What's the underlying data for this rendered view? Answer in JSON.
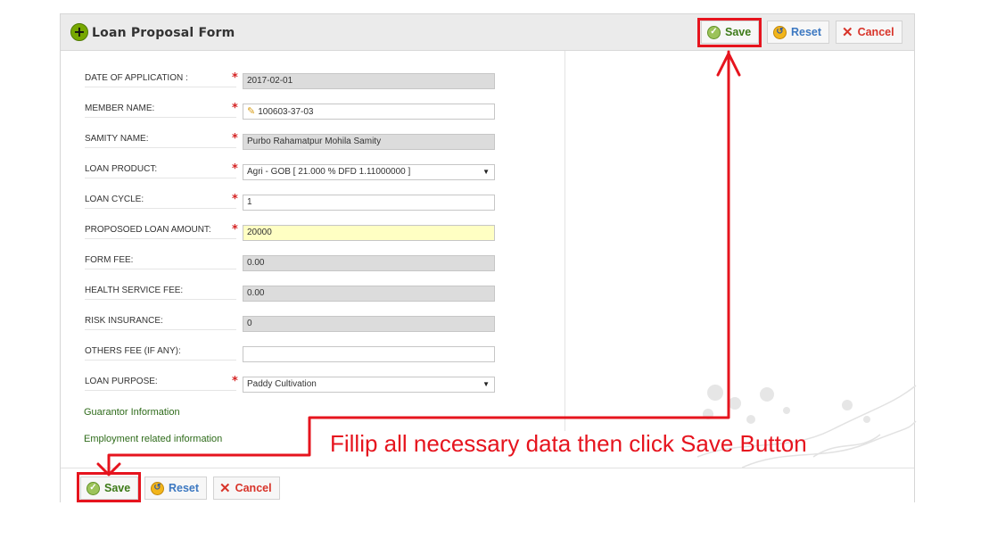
{
  "form": {
    "title": "Loan Proposal Form"
  },
  "toolbar": {
    "save_label": "Save",
    "reset_label": "Reset",
    "cancel_label": "Cancel"
  },
  "fields": {
    "date_of_application": {
      "label": "DATE OF APPLICATION :",
      "value": "2017-02-01",
      "required": true
    },
    "member_name": {
      "label": "MEMBER NAME:",
      "value": "100603-37-03",
      "required": true
    },
    "samity_name": {
      "label": "SAMITY NAME:",
      "value": "Purbo Rahamatpur Mohila Samity",
      "required": true
    },
    "loan_product": {
      "label": "LOAN PRODUCT:",
      "value": "Agri - GOB [ 21.000 % DFD 1.11000000 ]",
      "required": true
    },
    "loan_cycle": {
      "label": "LOAN CYCLE:",
      "value": "1",
      "required": true
    },
    "proposed_loan_amount": {
      "label": "PROPOSOED LOAN AMOUNT:",
      "value": "20000",
      "required": true
    },
    "form_fee": {
      "label": "FORM FEE:",
      "value": "0.00",
      "required": false
    },
    "health_service_fee": {
      "label": "HEALTH SERVICE FEE:",
      "value": "0.00",
      "required": false
    },
    "risk_insurance": {
      "label": "RISK INSURANCE:",
      "value": "0",
      "required": false
    },
    "others_fee": {
      "label": "OTHERS FEE (IF ANY):",
      "value": "",
      "required": false
    },
    "loan_purpose": {
      "label": "LOAN PURPOSE:",
      "value": "Paddy Cultivation",
      "required": true
    }
  },
  "links": {
    "guarantor": "Guarantor Information",
    "employment": "Employment related information"
  },
  "annotation": {
    "text": "Fillip all necessary data then click Save Button",
    "color": "#e6141e"
  },
  "colors": {
    "save_text": "#3d7a18",
    "reset_text": "#3c78c1",
    "cancel_text": "#d8342a",
    "link_green": "#2e6b1a"
  },
  "icons": {
    "title": "plus-circle-icon",
    "save": "check-icon",
    "reset": "reset-icon",
    "cancel": "close-icon",
    "member": "pencil-icon"
  }
}
